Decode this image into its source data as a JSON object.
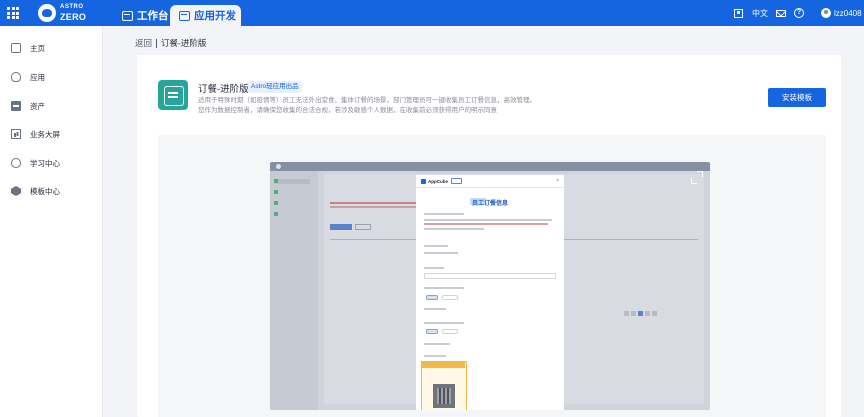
{
  "topbar": {
    "logo_top": "ASTRO",
    "logo_bottom": "ZERO",
    "tabs": [
      {
        "label": "工作台",
        "active": false
      },
      {
        "label": "应用开发",
        "active": true
      }
    ],
    "language": "中文",
    "username": "lzz0408",
    "icons": [
      "apps-grid-icon",
      "qr-code-icon",
      "mail-icon",
      "help-icon",
      "user-avatar-icon"
    ],
    "color": "#1565e0"
  },
  "sidebar": {
    "items": [
      {
        "label": "主页",
        "icon": "home-icon"
      },
      {
        "label": "应用",
        "icon": "app-icon"
      },
      {
        "label": "资产",
        "icon": "asset-icon"
      },
      {
        "label": "业务大屏",
        "icon": "dashboard-icon"
      },
      {
        "label": "学习中心",
        "icon": "learning-icon"
      },
      {
        "label": "模板中心",
        "icon": "template-icon"
      }
    ]
  },
  "breadcrumb": {
    "back": "返回",
    "current": "订餐-进阶版"
  },
  "template": {
    "title": "订餐-进阶版",
    "badge": "Astro轻应用出品",
    "description_line1": "适用于特殊时期（如疫情等）员工无法外出堂食、集体订餐的场景，部门管理员可一键收集员工订餐信息，高效管理。",
    "description_line2": "您作为数据控制者，请确保您收集的合法合规，若涉及敏感个人数据，在收集前必须获得用户的明示同意",
    "install_label": "安装模板",
    "icon_color": "#26a69a"
  },
  "preview": {
    "modal_app_name": "AppCube",
    "modal_title": "员工订餐信息",
    "close_glyph": "×"
  }
}
